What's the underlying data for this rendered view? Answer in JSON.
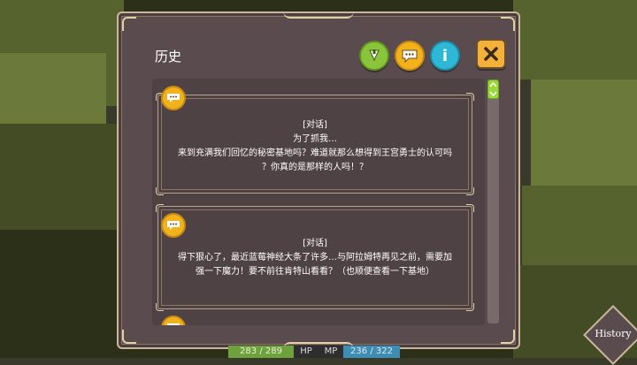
{
  "panel": {
    "title": "历史",
    "toolbar": {
      "filter_icon": "bell-filter-icon",
      "chat_icon": "speech-bubble-icon",
      "info_label": "i",
      "close_icon": "close-icon"
    }
  },
  "entries": [
    {
      "type_label": "[对话]",
      "lines": [
        "为了抓我…",
        "来到充满我们回忆的秘密基地吗？难道就那么想得到王宫勇士的认可吗",
        "？你真的是那样的人吗！？"
      ]
    },
    {
      "type_label": "[对话]",
      "lines": [
        "得下狠心了，最近蓝莓神经大条了许多…与阿拉姆特再见之前，需要加",
        "强一下魔力！要不前往肯特山看看？（也顺便查看一下基地）"
      ]
    }
  ],
  "hud": {
    "hp_value": "283 / 289",
    "hp_label": "HP",
    "mp_label": "MP",
    "mp_value": "236 / 322"
  },
  "history_button": "History",
  "colors": {
    "panel_bg": "#5a4c4e",
    "gold_border": "#c9b79a",
    "accent_orange": "#f2b21c",
    "accent_green": "#8ac43a",
    "accent_cyan": "#2fb8d6"
  }
}
